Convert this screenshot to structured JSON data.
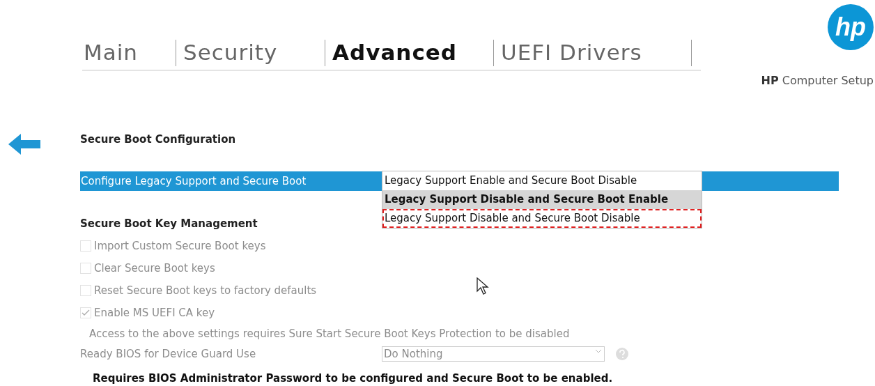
{
  "tabs": [
    {
      "label": "Main",
      "selected": false
    },
    {
      "label": "Security",
      "selected": false
    },
    {
      "label": "Advanced",
      "selected": true
    },
    {
      "label": "UEFI Drivers",
      "selected": false
    }
  ],
  "brand": {
    "logo": "hp",
    "caption_bold": "HP",
    "caption": "Computer Setup"
  },
  "section_title": "Secure Boot Configuration",
  "setting": {
    "label": "Configure Legacy Support and Secure Boot",
    "options": [
      {
        "label": "Legacy Support Enable and Secure Boot Disable",
        "selected": false,
        "outlined": false
      },
      {
        "label": "Legacy Support Disable and Secure Boot Enable",
        "selected": true,
        "outlined": false
      },
      {
        "label": "Legacy Support Disable and Secure Boot Disable",
        "selected": false,
        "outlined": true
      }
    ]
  },
  "key_management": {
    "title": "Secure Boot Key Management",
    "items": [
      {
        "label": "Import Custom Secure Boot keys",
        "checked": false,
        "disabled": true
      },
      {
        "label": "Clear Secure Boot keys",
        "checked": false,
        "disabled": true
      },
      {
        "label": "Reset Secure Boot keys to factory defaults",
        "checked": false,
        "disabled": true
      },
      {
        "label": "Enable MS UEFI CA key",
        "checked": true,
        "disabled": true
      }
    ],
    "note": "Access to the above settings requires Sure Start Secure Boot Keys Protection to be disabled"
  },
  "device_guard": {
    "label": "Ready BIOS for Device Guard Use",
    "value": "Do Nothing",
    "disabled": true
  },
  "footer_note": "Requires BIOS Administrator Password to be configured and Secure Boot to be enabled."
}
